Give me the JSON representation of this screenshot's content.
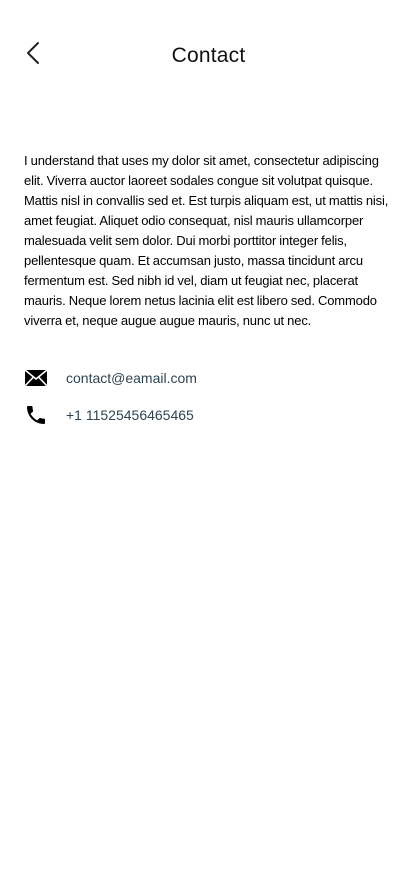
{
  "header": {
    "title": "Contact",
    "back_icon": "chevron-left-icon"
  },
  "main": {
    "description": "I understand that uses my  dolor sit amet, consectetur adipiscing elit. Viverra auctor laoreet sodales congue sit volutpat quisque. Mattis nisl in convallis sed et. Est turpis aliquam est, ut mattis nisi, amet feugiat. Aliquet odio consequat, nisl mauris ullamcorper malesuada velit sem dolor. Dui morbi porttitor integer felis, pellentesque quam. Et accumsan justo, massa tincidunt arcu fermentum est. Sed nibh id vel, diam ut feugiat nec, placerat mauris. Neque lorem netus lacinia elit est libero sed. Commodo viverra et, neque augue augue mauris, nunc ut nec.",
    "contacts": [
      {
        "icon": "envelope-icon",
        "value": "contact@eamail.com"
      },
      {
        "icon": "phone-icon",
        "value": "+1 11525456465465"
      }
    ]
  },
  "colors": {
    "background": "#ffffff",
    "text": "#000000",
    "contact_text": "#2f4452"
  }
}
